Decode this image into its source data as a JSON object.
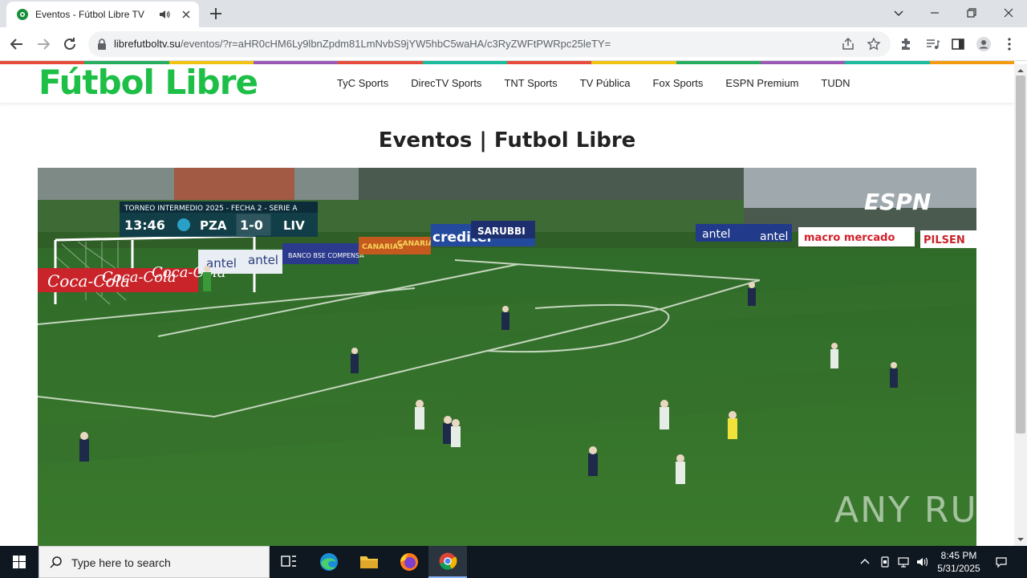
{
  "browser": {
    "tab_title": "Eventos - Fútbol Libre TV",
    "url_host": "librefutboltv.su",
    "url_path": "/eventos/?r=aHR0cHM6Ly9lbnZpdm81LmNvbS9jYW5hbC5waHA/c3RyZWFtPWRpc25leTY="
  },
  "site": {
    "logo_text": "Fútbol Libre",
    "brand_color": "#1dbf46",
    "nav": [
      "TyC Sports",
      "DirecTV Sports",
      "TNT Sports",
      "TV Pública",
      "Fox Sports",
      "ESPN Premium",
      "TUDN"
    ],
    "page_title": "Eventos | Futbol Libre"
  },
  "video": {
    "scoreboard": {
      "competition": "TORNEO INTERMEDIO 2025 - FECHA 2 - SERIE A",
      "clock": "13:46",
      "home": "PZA",
      "score": "1-0",
      "away": "LIV"
    },
    "broadcaster": "ESPN",
    "ads": [
      "Coca-Cola",
      "Coca-Cola",
      "Coca-Cola",
      "antel",
      "antel",
      "BANCO BSE COMPENSA",
      "CANARIAS",
      "CANARIAS",
      "creditel",
      "SARUBBI",
      "antel",
      "antel",
      "macro mercado",
      "PILSEN"
    ]
  },
  "watermark": "ANY RUN",
  "taskbar": {
    "search_placeholder": "Type here to search",
    "time": "8:45 PM",
    "date": "5/31/2025"
  }
}
